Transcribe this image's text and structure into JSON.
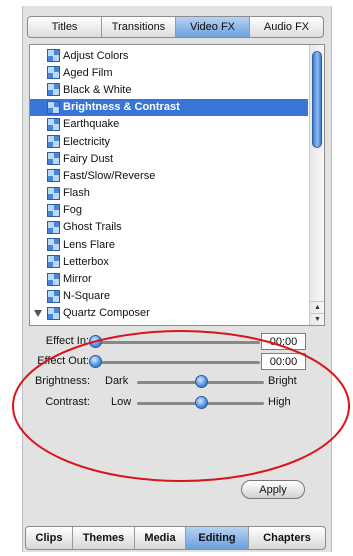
{
  "top_tabs": [
    {
      "label": "Titles",
      "active": false
    },
    {
      "label": "Transitions",
      "active": false
    },
    {
      "label": "Video FX",
      "active": true
    },
    {
      "label": "Audio FX",
      "active": false
    }
  ],
  "effects": [
    "Adjust Colors",
    "Aged Film",
    "Black & White",
    "Brightness & Contrast",
    "Earthquake",
    "Electricity",
    "Fairy Dust",
    "Fast/Slow/Reverse",
    "Flash",
    "Fog",
    "Ghost Trails",
    "Lens Flare",
    "Letterbox",
    "Mirror",
    "N-Square",
    "Quartz Composer"
  ],
  "selected_effect": "Brightness & Contrast",
  "controls": {
    "effect_in": {
      "label": "Effect In:",
      "value": "00:00",
      "level": 0.0
    },
    "effect_out": {
      "label": "Effect Out:",
      "value": "00:00",
      "level": 0.0
    },
    "brightness": {
      "label": "Brightness:",
      "min_label": "Dark",
      "max_label": "Bright",
      "level": 0.5
    },
    "contrast": {
      "label": "Contrast:",
      "min_label": "Low",
      "max_label": "High",
      "level": 0.5
    }
  },
  "apply_label": "Apply",
  "bottom_tabs": [
    {
      "label": "Clips",
      "active": false
    },
    {
      "label": "Themes",
      "active": false
    },
    {
      "label": "Media",
      "active": false
    },
    {
      "label": "Editing",
      "active": true
    },
    {
      "label": "Chapters",
      "active": false
    }
  ],
  "colors": {
    "selection": "#3875d7",
    "annotation": "#d9141b"
  }
}
